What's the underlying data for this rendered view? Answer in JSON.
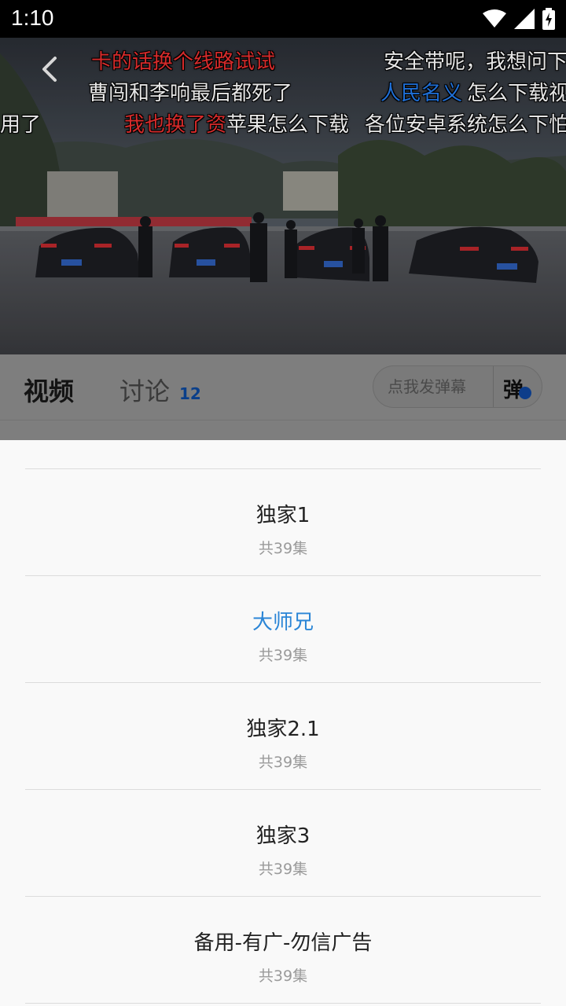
{
  "status_bar": {
    "time": "1:10"
  },
  "danmaku": [
    {
      "text": "卡的话换个线路试试",
      "color": "red"
    },
    {
      "text": "安全带呢，我想问下",
      "color": "white"
    },
    {
      "text": "曹闯和李响最后都死了",
      "color": "white"
    },
    {
      "text": "人民名义",
      "color": "blue"
    },
    {
      "text": "怎么下载视",
      "color": "white"
    },
    {
      "text": "用了",
      "color": "white"
    },
    {
      "text": "我也换了资",
      "color": "red"
    },
    {
      "text": "苹果怎么下载",
      "color": "white"
    },
    {
      "text": "各位安卓系统怎么下怕",
      "color": "white"
    }
  ],
  "tabs": {
    "video": "视频",
    "discussion": "讨论",
    "discussion_count": "12"
  },
  "danmaku_input": {
    "placeholder": "点我发弹幕",
    "toggle_label": "弹"
  },
  "sources": [
    {
      "name": "独家1",
      "count": "共39集",
      "active": false
    },
    {
      "name": "大师兄",
      "count": "共39集",
      "active": true
    },
    {
      "name": "独家2.1",
      "count": "共39集",
      "active": false
    },
    {
      "name": "独家3",
      "count": "共39集",
      "active": false
    },
    {
      "name": "备用-有广-勿信广告",
      "count": "共39集",
      "active": false
    }
  ],
  "colors": {
    "active_source": "#2a85d6",
    "danmaku_red": "#d62b2b",
    "danmaku_blue": "#1f6fd6"
  }
}
